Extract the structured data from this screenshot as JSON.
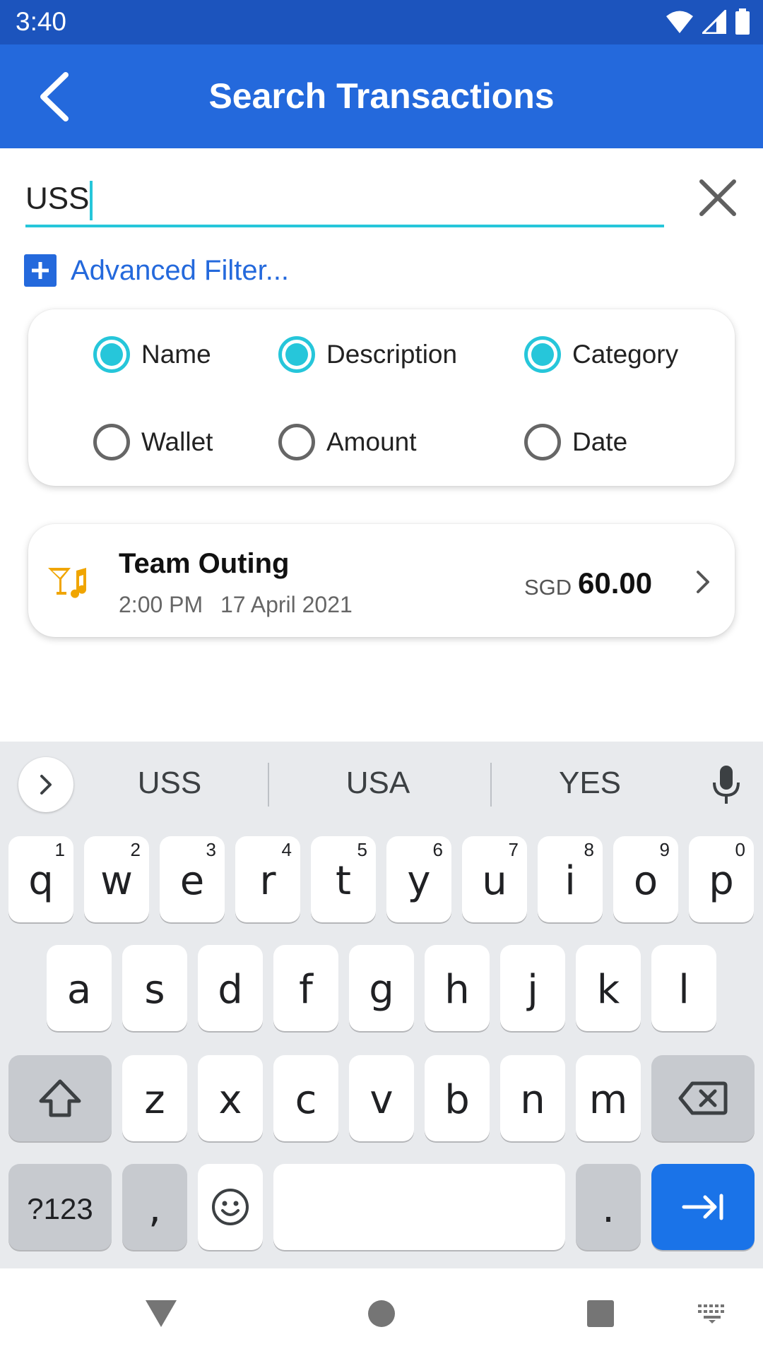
{
  "status_bar": {
    "time": "3:40"
  },
  "app_bar": {
    "title": "Search Transactions"
  },
  "search": {
    "value": "USS"
  },
  "advanced_filter": {
    "label": "Advanced Filter..."
  },
  "filters": [
    {
      "label": "Name",
      "checked": true
    },
    {
      "label": "Description",
      "checked": true
    },
    {
      "label": "Category",
      "checked": true
    },
    {
      "label": "Wallet",
      "checked": false
    },
    {
      "label": "Amount",
      "checked": false
    },
    {
      "label": "Date",
      "checked": false
    }
  ],
  "transaction": {
    "name": "Team Outing",
    "time": "2:00 PM",
    "date": "17 April 2021",
    "currency": "SGD",
    "amount": "60.00",
    "icon": "cocktail-music-icon",
    "icon_color": "#f0a500"
  },
  "keyboard": {
    "suggestions": [
      "USS",
      "USA",
      "YES"
    ],
    "row1": [
      {
        "key": "q",
        "hint": "1"
      },
      {
        "key": "w",
        "hint": "2"
      },
      {
        "key": "e",
        "hint": "3"
      },
      {
        "key": "r",
        "hint": "4"
      },
      {
        "key": "t",
        "hint": "5"
      },
      {
        "key": "y",
        "hint": "6"
      },
      {
        "key": "u",
        "hint": "7"
      },
      {
        "key": "i",
        "hint": "8"
      },
      {
        "key": "o",
        "hint": "9"
      },
      {
        "key": "p",
        "hint": "0"
      }
    ],
    "row2": [
      "a",
      "s",
      "d",
      "f",
      "g",
      "h",
      "j",
      "k",
      "l"
    ],
    "row3": [
      "z",
      "x",
      "c",
      "v",
      "b",
      "n",
      "m"
    ],
    "symbols_label": "?123",
    "comma": ",",
    "period": "."
  },
  "colors": {
    "status_bar": "#1c54bd",
    "app_bar": "#2469dc",
    "accent": "#26c6da",
    "keyboard_action": "#1a73e8"
  }
}
